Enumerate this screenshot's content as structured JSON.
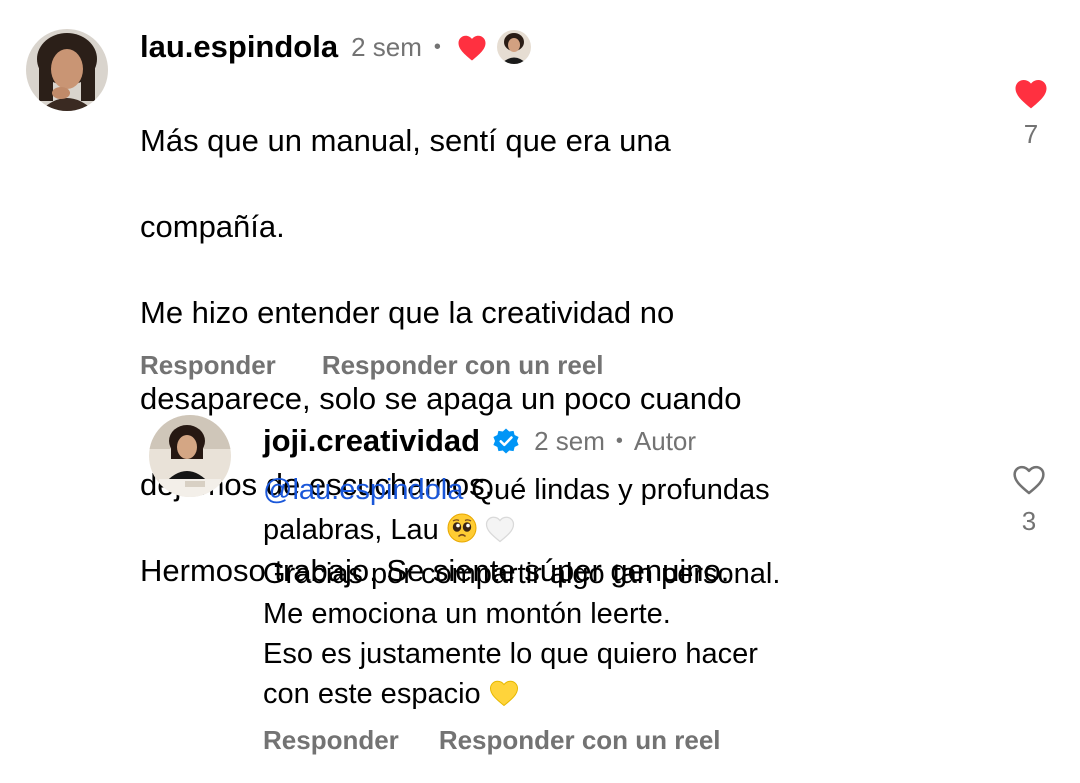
{
  "comment": {
    "username": "lau.espindola",
    "time": "2 sem",
    "separator": "•",
    "lines": [
      "Más que un manual, sentí que era una",
      "compañía.",
      "Me hizo entender que la creatividad no",
      "desaparece, solo se apaga un poco cuando",
      "dejamos de escucharnos.",
      "Hermoso trabajo. Se siente súper genuino."
    ],
    "like_count": "7",
    "liked": true,
    "reply_label": "Responder",
    "reel_reply_label": "Responder con un reel"
  },
  "reply": {
    "username": "joji.creatividad",
    "verified": true,
    "time": "2 sem",
    "separator": "•",
    "author_badge": "Autor",
    "mention": "@lau.espindola",
    "line1_rest": " Qué lindas y profundas",
    "line2": "palabras, Lau",
    "line3": "Gracias por compartir algo tan personal.",
    "line4": "Me emociona un montón leerte.",
    "line5": "Eso es justamente lo que quiero hacer",
    "line6": "con este espacio",
    "like_count": "3",
    "liked": false,
    "reply_label": "Responder",
    "reel_reply_label": "Responder con un reel"
  },
  "colors": {
    "heart_red": "#ff3040",
    "verified_blue": "#0095f6",
    "secondary_text": "#737373",
    "mention_blue": "#1a57d9"
  },
  "icons": {
    "liked_heart": "heart-filled-icon",
    "unliked_heart": "heart-outline-icon",
    "verified": "verified-badge-icon",
    "emoji_pleading": "pleading-face-emoji",
    "emoji_white_heart": "white-heart-emoji",
    "emoji_yellow_heart": "yellow-heart-emoji"
  }
}
